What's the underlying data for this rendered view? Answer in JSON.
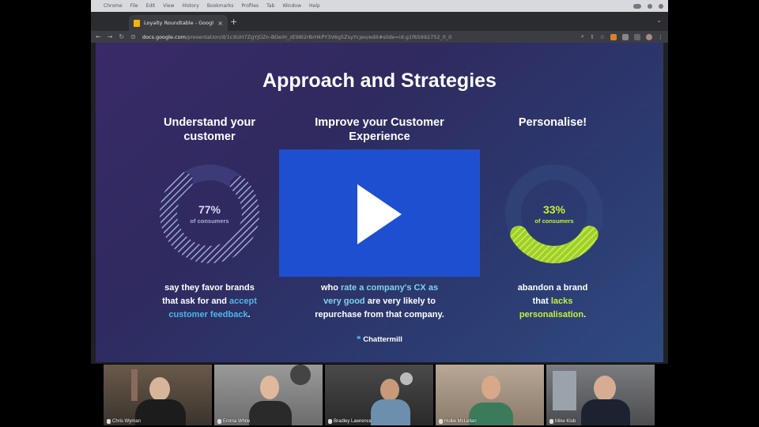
{
  "macbar": {
    "apple": "",
    "menu": [
      "Chrome",
      "File",
      "Edit",
      "View",
      "History",
      "Bookmarks",
      "Profiles",
      "Tab",
      "Window",
      "Help"
    ]
  },
  "browser": {
    "tab_title": "Loyalty Roundtable - Google",
    "tab_close": "×",
    "new_tab": "+",
    "url_domain": "docs.google.com",
    "url_path": "/presentation/d/1cXUH7ZgYjOZn-BOeiH_zE98l2rBrHkPY3V6g5ZsyYcjeo/edit#slide=id.g1f65992752_0_0"
  },
  "slide": {
    "title": "Approach and Strategies",
    "columns": [
      {
        "heading": [
          "Understand your",
          "customer"
        ],
        "pct": "77%",
        "sub": "of consumers",
        "ring_color": "#b7bce8",
        "ring_value": 0.77,
        "body": [
          {
            "t": "say they favor brands",
            "c": ""
          },
          {
            "t": "that ask for and ",
            "c": ""
          },
          {
            "t": "accept",
            "c": "hl"
          },
          {
            "t": "customer feedback",
            "c": "hl"
          },
          {
            "t": ".",
            "c": ""
          }
        ]
      },
      {
        "heading": [
          "Improve your Customer",
          "Experience"
        ],
        "body": [
          {
            "t": "who ",
            "c": ""
          },
          {
            "t": "rate a company's CX as",
            "c": "hlv"
          },
          {
            "t": "very good",
            "c": "hlv"
          },
          {
            "t": " are very likely to",
            "c": ""
          },
          {
            "t": "repurchase from that company.",
            "c": ""
          }
        ]
      },
      {
        "heading": [
          "Personalise!"
        ],
        "pct": "33%",
        "sub": "of consumers",
        "ring_color": "#c6ef3a",
        "ring_value": 0.33,
        "body": [
          {
            "t": "abandon a brand",
            "c": ""
          },
          {
            "t": "that ",
            "c": ""
          },
          {
            "t": "lacks",
            "c": "hlg"
          },
          {
            "t": "personalisation",
            "c": "hlg"
          },
          {
            "t": ".",
            "c": ""
          }
        ]
      }
    ],
    "logo": "Chattermill"
  },
  "participants": [
    {
      "name": "Chris Wyman"
    },
    {
      "name": "Emma White"
    },
    {
      "name": "Bradley Lawrence"
    },
    {
      "name": "Hollie McLellan"
    },
    {
      "name": "Mike Klub"
    }
  ],
  "colors": {
    "accent_blue": "#4fb6e8",
    "accent_green": "#c6ef3a",
    "player_blue": "#1f4fd1"
  },
  "icons": [
    "apple-icon",
    "favicon-icon",
    "close-icon",
    "new-tab-icon",
    "back-icon",
    "forward-icon",
    "reload-icon",
    "lock-icon",
    "zoom-icon",
    "share-icon",
    "bookmark-star-icon",
    "play-icon",
    "chattermill-logo-icon",
    "mic-icon"
  ]
}
